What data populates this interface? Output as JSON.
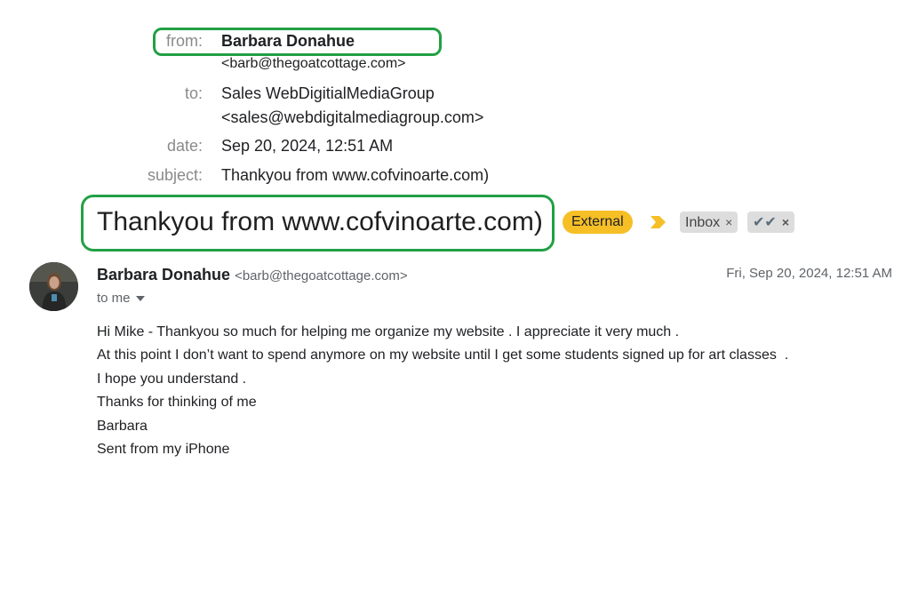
{
  "meta": {
    "from_label": "from:",
    "from_name": "Barbara Donahue",
    "from_email": "<barb@thegoatcottage.com>",
    "to_label": "to:",
    "to_name": "Sales WebDigitialMediaGroup",
    "to_email": "<sales@webdigitalmediagroup.com>",
    "date_label": "date:",
    "date_value": "Sep 20, 2024, 12:51 AM",
    "subject_label": "subject:",
    "subject_value": "Thankyou from www.cofvinoarte.com)"
  },
  "subject_title": "Thankyou from www.cofvinoarte.com)",
  "labels": {
    "external": "External",
    "inbox": "Inbox",
    "check": "✔✔",
    "remove": "×"
  },
  "message": {
    "sender_name": "Barbara Donahue",
    "sender_email": "<barb@thegoatcottage.com>",
    "date": "Fri, Sep 20, 2024, 12:51 AM",
    "to_me": "to me",
    "body": [
      "Hi Mike - Thankyou so much for helping me organize my website . I appreciate it very much .",
      "At this point I don’t want to spend anymore on my website until I get some students signed up for art classes  .",
      "I hope you understand .",
      "Thanks for thinking of me",
      "Barbara",
      "Sent from my iPhone"
    ]
  },
  "colors": {
    "highlight": "#22a045",
    "external_badge": "#f6bf26",
    "importance_marker": "#f6bf26",
    "chip_bg": "#dddddd"
  }
}
